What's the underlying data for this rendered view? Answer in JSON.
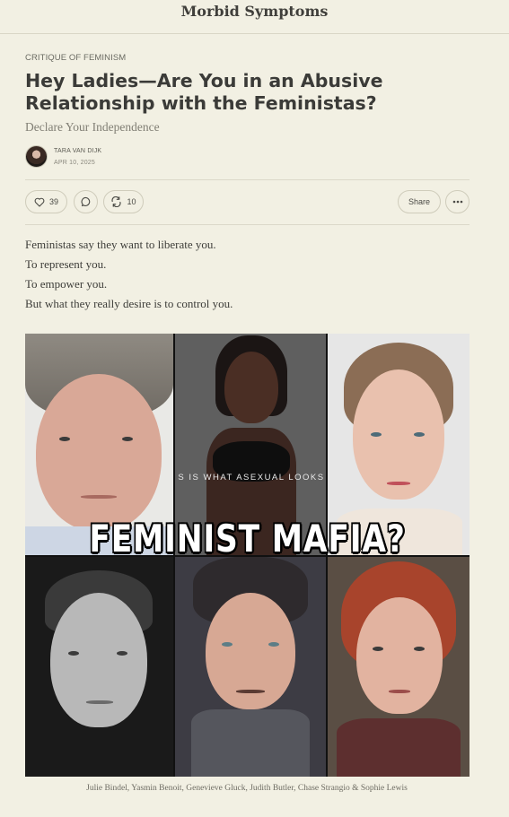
{
  "header": {
    "publication": "Morbid Symptoms"
  },
  "post": {
    "category": "CRITIQUE OF FEMINISM",
    "title": "Hey Ladies—Are You in an Abusive Relationship with the Feministas?",
    "subtitle": "Declare Your Independence",
    "author": "TARA VAN DIJK",
    "date": "APR 10, 2025"
  },
  "actions": {
    "likes": "39",
    "restacks": "10",
    "share_label": "Share",
    "icons": {
      "like": "heart-icon",
      "comment": "comment-bubble-icon",
      "restack": "restack-arrows-icon",
      "more": "ellipsis-icon"
    }
  },
  "body": {
    "paragraphs": [
      "Feministas say they want to liberate you.",
      "To represent you.",
      "To empower you.",
      "But what they really desire is to control you."
    ]
  },
  "image": {
    "overlay_text": "FEMINIST MAFIA?",
    "tagline": "S IS WHAT ASEXUAL LOOKS",
    "caption": "Julie Bindel, Yasmin Benoit, Genevieve Gluck, Judith Butler, Chase Strangio & Sophie Lewis"
  },
  "colors": {
    "background": "#f2f0e3",
    "text": "#363737",
    "muted": "#807e74",
    "border": "#cfccbb"
  }
}
